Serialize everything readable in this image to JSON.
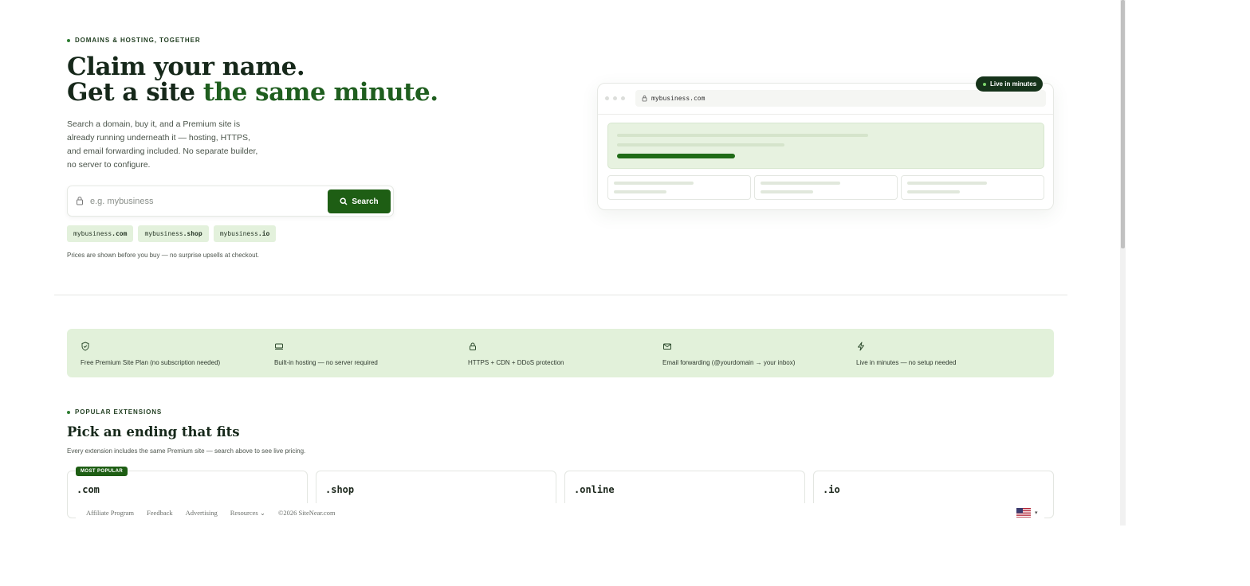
{
  "hero": {
    "eyebrow": "DOMAINS & HOSTING, TOGETHER",
    "title_line1": "Claim your name.",
    "title_line2_prefix": "Get a site ",
    "title_line2_accent": "the same minute.",
    "description": "Search a domain, buy it, and a Premium site is already running underneath it — hosting, HTTPS, and email forwarding included. No separate builder, no server to configure."
  },
  "search": {
    "placeholder": "e.g. mybusiness",
    "button_label": "Search"
  },
  "suggestions": [
    {
      "name": "mybusiness",
      "tld": ".com"
    },
    {
      "name": "mybusiness",
      "tld": ".shop"
    },
    {
      "name": "mybusiness",
      "tld": ".io"
    }
  ],
  "price_note": "Prices are shown before you buy — no surprise upsells at checkout.",
  "mockup": {
    "url": "mybusiness.com",
    "badge": "Live in minutes"
  },
  "features": [
    {
      "icon": "shield-check-icon",
      "label": "Free Premium Site Plan (no subscription needed)"
    },
    {
      "icon": "server-icon",
      "label": "Built-in hosting — no server required"
    },
    {
      "icon": "lock-icon",
      "label": "HTTPS + CDN + DDoS protection"
    },
    {
      "icon": "mail-icon",
      "label": "Email forwarding (@yourdomain → your inbox)"
    },
    {
      "icon": "lightning-icon",
      "label": "Live in minutes — no setup needed"
    }
  ],
  "extensions": {
    "eyebrow": "POPULAR EXTENSIONS",
    "title": "Pick an ending that fits",
    "subtitle": "Every extension includes the same Premium site — search above to see live pricing.",
    "popular_badge": "MOST POPULAR",
    "items": [
      ".com",
      ".shop",
      ".online",
      ".io"
    ]
  },
  "footer": {
    "links": [
      "Affiliate Program",
      "Feedback",
      "Advertising",
      "Resources ⌄"
    ],
    "copyright": "©2026 SiteNear.com",
    "language_flag": "us-flag-icon"
  },
  "colors": {
    "brand_green": "#1e5e14",
    "accent_text": "#1f5e1f",
    "feature_band": "#e2f1da",
    "chip_bg": "#e3f1dc"
  }
}
